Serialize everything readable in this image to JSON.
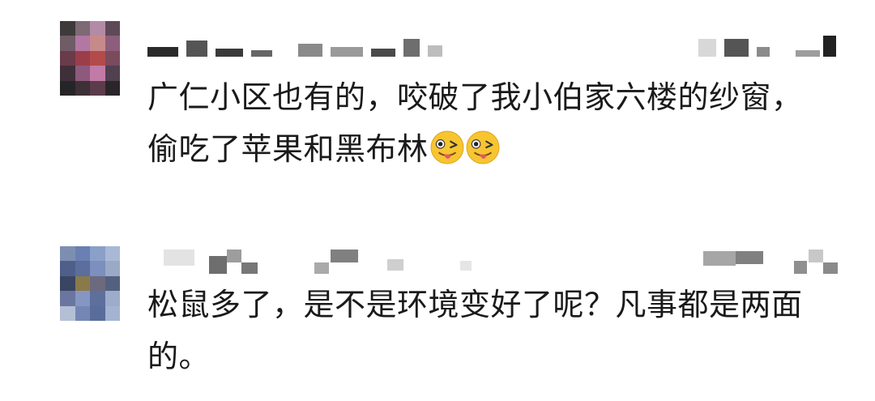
{
  "comments": [
    {
      "text": "广仁小区也有的，咬破了我小伯家六楼的纱窗，偷吃了苹果和黑布林",
      "emojis": [
        "winking-tongue-face-emoji",
        "winking-tongue-face-emoji"
      ]
    },
    {
      "text": "松鼠多了，是不是环境变好了呢？凡事都是两面的。",
      "emojis": []
    }
  ],
  "colors": {
    "text": "#1a1a1a",
    "background": "#ffffff",
    "emoji_face": "#f7c531"
  }
}
